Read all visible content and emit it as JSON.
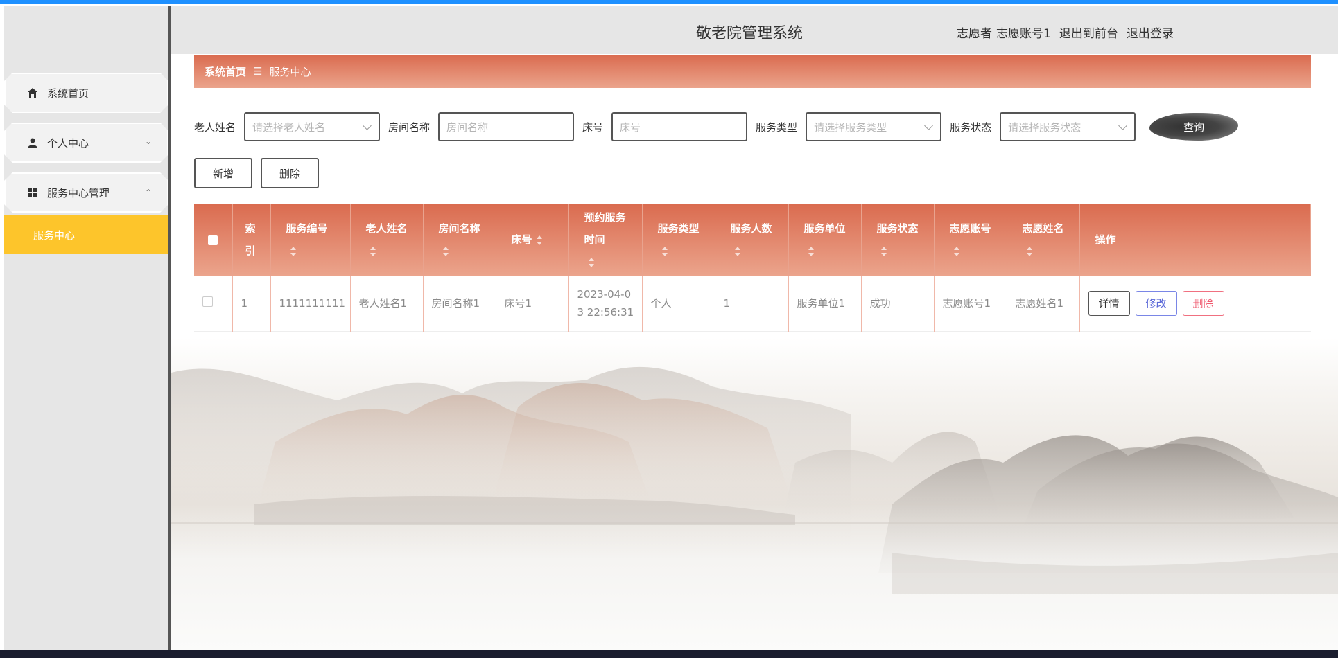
{
  "header": {
    "title": "敬老院管理系统",
    "role": "志愿者",
    "username": "志愿账号1",
    "to_front": "退出到前台",
    "logout": "退出登录"
  },
  "sidebar": {
    "items": [
      {
        "label": "系统首页",
        "icon": "home-icon"
      },
      {
        "label": "个人中心",
        "icon": "user-icon"
      },
      {
        "label": "服务中心管理",
        "icon": "grid-icon"
      }
    ],
    "sub_item": "服务中心"
  },
  "breadcrumb": {
    "home": "系统首页",
    "separator": "☰",
    "current": "服务中心"
  },
  "filters": {
    "elder_name": {
      "label": "老人姓名",
      "placeholder": "请选择老人姓名"
    },
    "room_name": {
      "label": "房间名称",
      "placeholder": "房间名称"
    },
    "bed_no": {
      "label": "床号",
      "placeholder": "床号"
    },
    "service_type": {
      "label": "服务类型",
      "placeholder": "请选择服务类型"
    },
    "service_status": {
      "label": "服务状态",
      "placeholder": "请选择服务状态"
    },
    "search_label": "查询"
  },
  "actions": {
    "add": "新增",
    "delete": "删除"
  },
  "table": {
    "headers": {
      "index": "索引",
      "service_no": "服务编号",
      "elder_name": "老人姓名",
      "room_name": "房间名称",
      "bed_no": "床号",
      "appoint_time": "预约服务时间",
      "service_type": "服务类型",
      "service_count": "服务人数",
      "service_unit": "服务单位",
      "service_status": "服务状态",
      "volunteer_account": "志愿账号",
      "volunteer_name": "志愿姓名",
      "ops": "操作"
    },
    "rows": [
      {
        "index": "1",
        "service_no": "1111111111",
        "elder_name": "老人姓名1",
        "room_name": "房间名称1",
        "bed_no": "床号1",
        "appoint_time": "2023-04-03 22:56:31",
        "service_type": "个人",
        "service_count": "1",
        "service_unit": "服务单位1",
        "service_status": "成功",
        "volunteer_account": "志愿账号1",
        "volunteer_name": "志愿姓名1"
      }
    ],
    "row_ops": {
      "detail": "详情",
      "edit": "修改",
      "delete": "删除"
    }
  },
  "colors": {
    "accent": "#da6b4f",
    "active_menu": "#fdc52b",
    "sidebar_bg": "#e6e6e6"
  }
}
